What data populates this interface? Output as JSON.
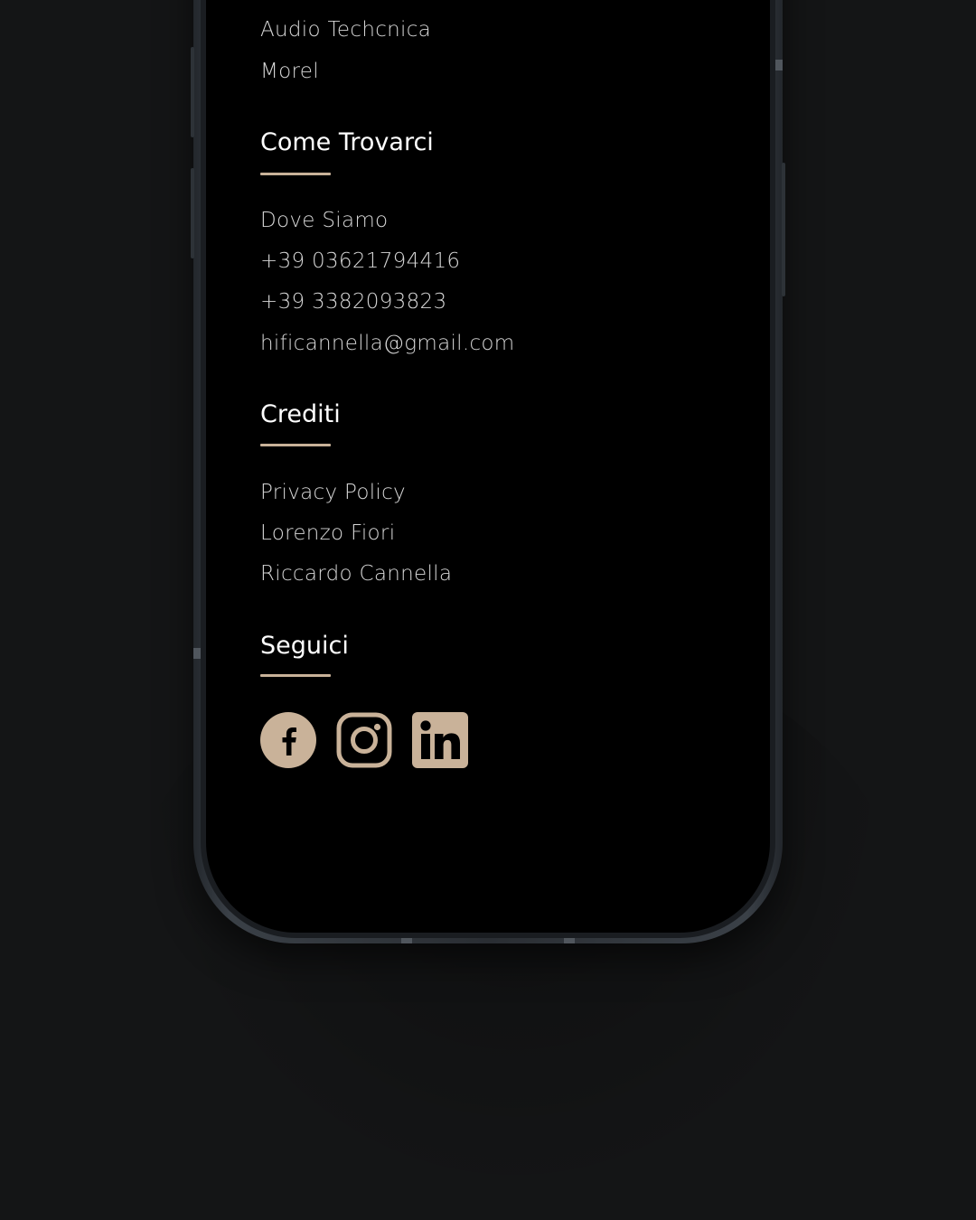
{
  "colors": {
    "background": "#141516",
    "screen": "#000000",
    "accent": "#c9b299",
    "text": "#d6d6d6",
    "heading": "#ffffff"
  },
  "top_links": [
    "Audio Techcnica",
    "Morel"
  ],
  "sections": {
    "come_trovarci": {
      "title": "Come Trovarci",
      "items": [
        "Dove Siamo",
        "+39 03621794416",
        "+39 3382093823",
        "hificannella@gmail.com"
      ]
    },
    "crediti": {
      "title": "Crediti",
      "items": [
        "Privacy Policy",
        "Lorenzo Fiori",
        "Riccardo Cannella"
      ]
    },
    "seguici": {
      "title": "Seguici",
      "icons": [
        "facebook-icon",
        "instagram-icon",
        "linkedin-icon"
      ]
    }
  }
}
